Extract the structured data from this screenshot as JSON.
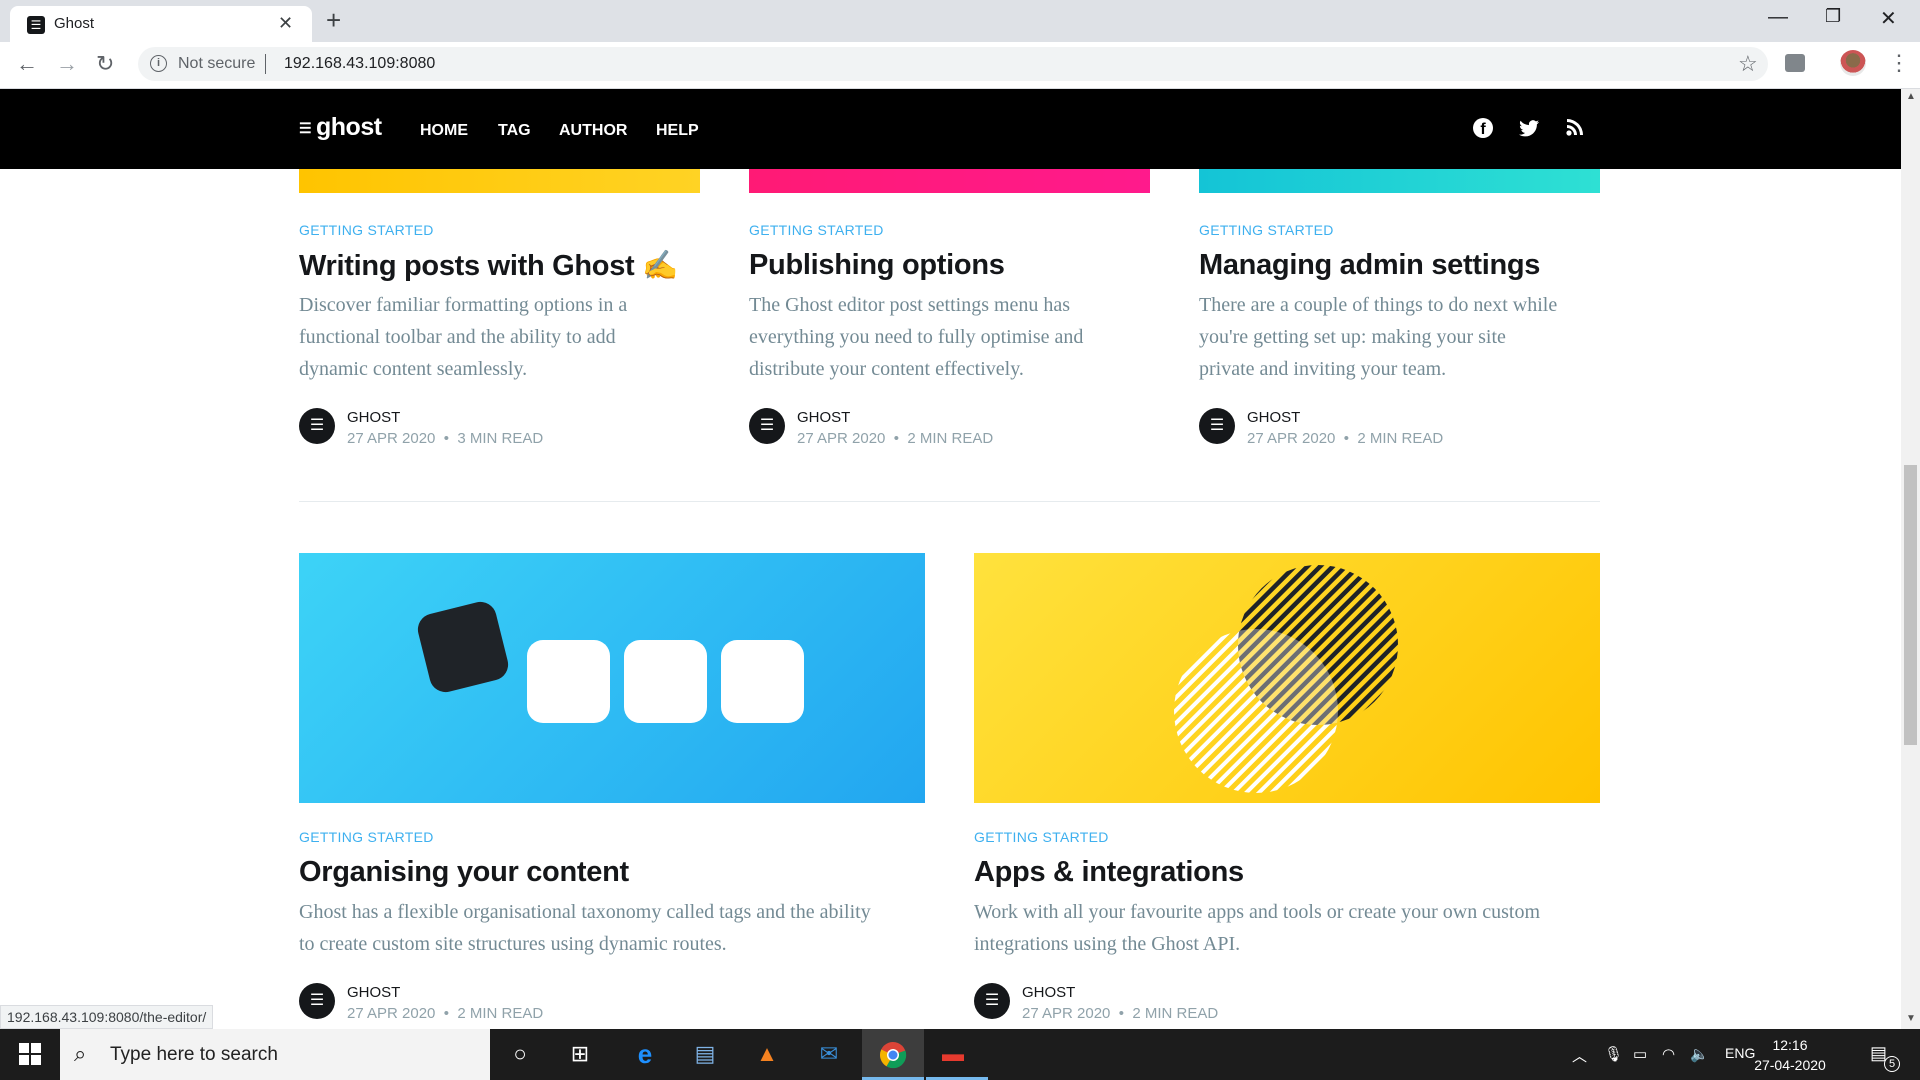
{
  "browser": {
    "tab_title": "Ghost",
    "tab_close": "✕",
    "new_tab": "+",
    "security_label": "Not secure",
    "url": "192.168.43.109:8080",
    "status_url": "192.168.43.109:8080/the-editor/"
  },
  "site": {
    "logo": "ghost",
    "nav": [
      "HOME",
      "TAG",
      "AUTHOR",
      "HELP"
    ],
    "social_icons": [
      "facebook-icon",
      "twitter-icon",
      "rss-icon"
    ]
  },
  "top_posts": [
    {
      "tag": "GETTING STARTED",
      "title": "Writing posts with Ghost ✍️",
      "excerpt": [
        "Discover familiar formatting options in a",
        "functional toolbar and the ability to add",
        "dynamic content seamlessly."
      ],
      "author": "GHOST",
      "date": "27 APR 2020",
      "read": "3 MIN READ",
      "image_color": "#ffc60a"
    },
    {
      "tag": "GETTING STARTED",
      "title": "Publishing options",
      "excerpt": [
        "The Ghost editor post settings menu has",
        "everything you need to fully optimise and",
        "distribute your content effectively."
      ],
      "author": "GHOST",
      "date": "27 APR 2020",
      "read": "2 MIN READ",
      "image_color": "#ff1a75"
    },
    {
      "tag": "GETTING STARTED",
      "title": "Managing admin settings",
      "excerpt": [
        "There are a couple of things to do next while",
        "you're getting set up: making your site",
        "private and inviting your team."
      ],
      "author": "GHOST",
      "date": "27 APR 2020",
      "read": "2 MIN READ",
      "image_color": "#1ecbd3"
    }
  ],
  "bottom_posts": [
    {
      "tag": "GETTING STARTED",
      "title": "Organising your content",
      "excerpt": [
        "Ghost has a flexible organisational taxonomy called tags and the ability",
        "to create custom site structures using dynamic routes."
      ],
      "author": "GHOST",
      "date": "27 APR 2020",
      "read": "2 MIN READ",
      "image_color": "#2fc1f7"
    },
    {
      "tag": "GETTING STARTED",
      "title": "Apps & integrations",
      "excerpt": [
        "Work with all your favourite apps and tools or create your own custom",
        "integrations using the Ghost API."
      ],
      "author": "GHOST",
      "date": "27 APR 2020",
      "read": "2 MIN READ",
      "image_color": "#ffd21a"
    }
  ],
  "meta_separator": "•",
  "taskbar": {
    "search_placeholder": "Type here to search",
    "language": "ENG",
    "time": "12:16",
    "date": "27-04-2020",
    "notification_count": "5"
  }
}
